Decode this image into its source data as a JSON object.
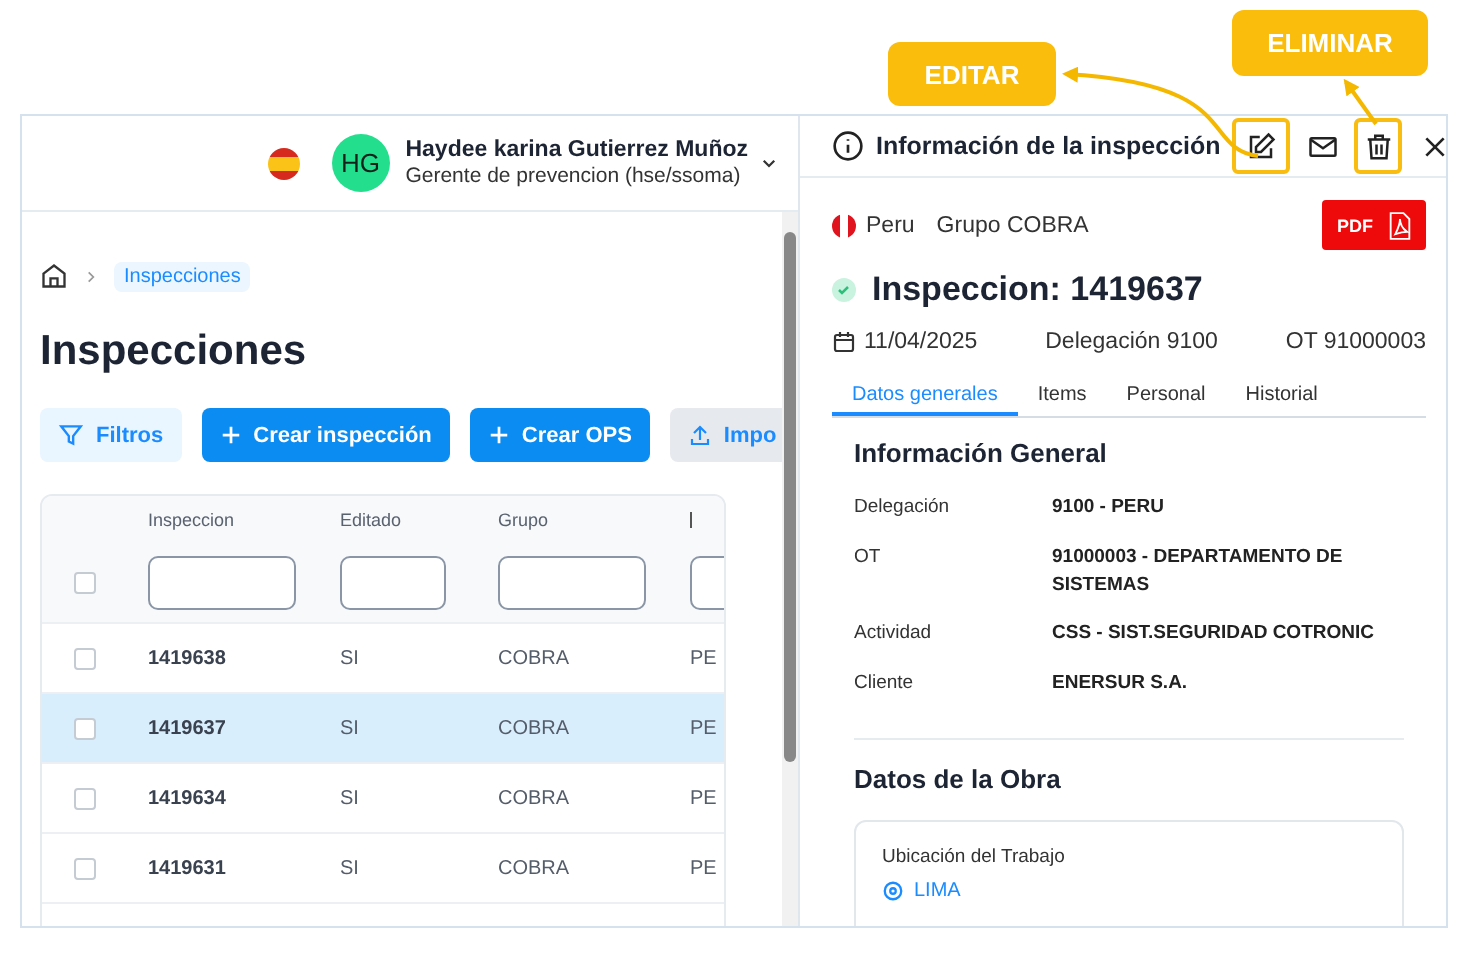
{
  "annotations": [
    {
      "label": "EDITAR"
    },
    {
      "label": "ELIMINAR"
    }
  ],
  "user": {
    "initials": "HG",
    "name": "Haydee karina Gutierrez Muñoz",
    "role": "Gerente de prevencion (hse/ssoma)"
  },
  "breadcrumb": [
    "Inspecciones"
  ],
  "page_title": "Inspecciones",
  "toolbar": [
    {
      "kind": "filter",
      "label": "Filtros"
    },
    {
      "kind": "create",
      "label": "Crear inspección"
    },
    {
      "kind": "create",
      "label": "Crear OPS"
    },
    {
      "kind": "import",
      "label": "Impo"
    }
  ],
  "table": {
    "select_all_checked": false,
    "columns": [
      {
        "label": "Inspeccion"
      },
      {
        "label": "Editado"
      },
      {
        "label": "Grupo"
      },
      {}
    ],
    "rows": [
      {
        "selected": false,
        "checked": false,
        "cells": [
          "1419638",
          "SI",
          "COBRA",
          "PE"
        ]
      },
      {
        "selected": true,
        "checked": false,
        "cells": [
          "1419637",
          "SI",
          "COBRA",
          "PE"
        ]
      },
      {
        "selected": false,
        "checked": false,
        "cells": [
          "1419634",
          "SI",
          "COBRA",
          "PE"
        ]
      },
      {
        "selected": false,
        "checked": false,
        "cells": [
          "1419631",
          "SI",
          "COBRA",
          "PE"
        ]
      }
    ]
  },
  "panel": {
    "title": "Información de la inspección",
    "header_actions": [
      {
        "kind": "edit",
        "highlighted": true
      },
      {
        "kind": "mail",
        "highlighted": false
      },
      {
        "kind": "delete",
        "highlighted": true
      },
      {
        "kind": "close",
        "highlighted": false
      }
    ],
    "country": "Peru",
    "group": "Grupo COBRA",
    "pdf_label": "PDF",
    "heading": "Inspeccion: 1419637",
    "date": "11/04/2025",
    "delegation": "Delegación 9100",
    "ot": "OT 91000003",
    "tabs": [
      {
        "label": "Datos generales",
        "selected": true
      },
      {
        "label": "Items",
        "selected": false
      },
      {
        "label": "Personal",
        "selected": false
      },
      {
        "label": "Historial",
        "selected": false
      }
    ],
    "section_title": "Información General",
    "fields": [
      {
        "label": "Delegación",
        "value": "9100 - PERU"
      },
      {
        "label": "OT",
        "value": "91000003 - DEPARTAMENTO DE SISTEMAS"
      },
      {
        "label": "Actividad",
        "value": "CSS - SIST.SEGURIDAD COTRONIC"
      },
      {
        "label": "Cliente",
        "value": "ENERSUR S.A."
      }
    ],
    "section2_title": "Datos de la Obra",
    "card_label": "Ubicación del Trabajo",
    "location": "LIMA"
  }
}
